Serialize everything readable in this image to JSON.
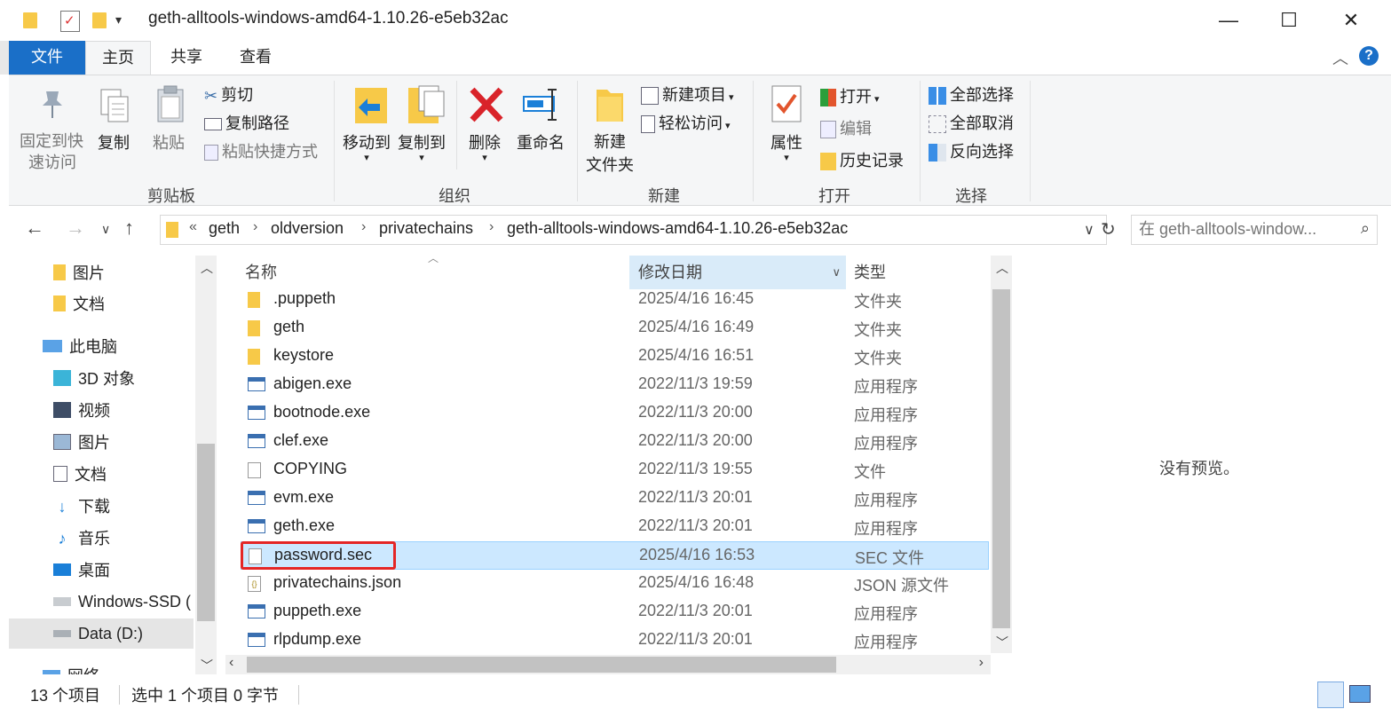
{
  "window": {
    "title": "geth-alltools-windows-amd64-1.10.26-e5eb32ac",
    "minimize": "—",
    "maximize": "☐",
    "close": "✕"
  },
  "tabs": [
    {
      "label": "文件"
    },
    {
      "label": "主页"
    },
    {
      "label": "共享"
    },
    {
      "label": "查看"
    }
  ],
  "ribbon": {
    "clipboard": {
      "group_label": "剪贴板",
      "pin_line1": "固定到快",
      "pin_line2": "速访问",
      "copy": "复制",
      "paste": "粘贴",
      "cut": "剪切",
      "copy_path": "复制路径",
      "paste_shortcut": "粘贴快捷方式"
    },
    "organize": {
      "group_label": "组织",
      "move_to": "移动到",
      "copy_to": "复制到",
      "delete": "删除",
      "rename": "重命名"
    },
    "new": {
      "group_label": "新建",
      "new_folder_line1": "新建",
      "new_folder_line2": "文件夹",
      "new_item": "新建项目",
      "easy_access": "轻松访问"
    },
    "open": {
      "group_label": "打开",
      "properties": "属性",
      "open": "打开",
      "edit": "编辑",
      "history": "历史记录"
    },
    "select": {
      "group_label": "选择",
      "select_all": "全部选择",
      "select_none": "全部取消",
      "invert": "反向选择"
    }
  },
  "address": {
    "overflow": "«",
    "crumbs": [
      "geth",
      "oldversion",
      "privatechains",
      "geth-alltools-windows-amd64-1.10.26-e5eb32ac"
    ],
    "search_placeholder": "在 geth-alltools-window..."
  },
  "nav_pane": [
    {
      "label": "图片",
      "icon": "folder-icon"
    },
    {
      "label": "文档",
      "icon": "folder-icon"
    },
    {
      "label": "此电脑",
      "icon": "computer-icon"
    },
    {
      "label": "3D 对象",
      "icon": "3d-objects-icon"
    },
    {
      "label": "视频",
      "icon": "video-icon"
    },
    {
      "label": "图片",
      "icon": "pictures-icon"
    },
    {
      "label": "文档",
      "icon": "documents-icon"
    },
    {
      "label": "下载",
      "icon": "download-icon"
    },
    {
      "label": "音乐",
      "icon": "music-icon"
    },
    {
      "label": "桌面",
      "icon": "desktop-icon"
    },
    {
      "label": "Windows-SSD (",
      "icon": "drive-icon"
    },
    {
      "label": "Data (D:)",
      "icon": "drive-icon"
    },
    {
      "label": "网络",
      "icon": "network-icon"
    }
  ],
  "columns": {
    "name": "名称",
    "date": "修改日期",
    "type": "类型"
  },
  "files": [
    {
      "name": ".puppeth",
      "date": "2025/4/16 16:45",
      "type": "文件夹",
      "kind": "folder"
    },
    {
      "name": "geth",
      "date": "2025/4/16 16:49",
      "type": "文件夹",
      "kind": "folder"
    },
    {
      "name": "keystore",
      "date": "2025/4/16 16:51",
      "type": "文件夹",
      "kind": "folder"
    },
    {
      "name": "abigen.exe",
      "date": "2022/11/3 19:59",
      "type": "应用程序",
      "kind": "exe"
    },
    {
      "name": "bootnode.exe",
      "date": "2022/11/3 20:00",
      "type": "应用程序",
      "kind": "exe"
    },
    {
      "name": "clef.exe",
      "date": "2022/11/3 20:00",
      "type": "应用程序",
      "kind": "exe"
    },
    {
      "name": "COPYING",
      "date": "2022/11/3 19:55",
      "type": "文件",
      "kind": "file"
    },
    {
      "name": "evm.exe",
      "date": "2022/11/3 20:01",
      "type": "应用程序",
      "kind": "exe"
    },
    {
      "name": "geth.exe",
      "date": "2022/11/3 20:01",
      "type": "应用程序",
      "kind": "exe"
    },
    {
      "name": "password.sec",
      "date": "2025/4/16 16:53",
      "type": "SEC 文件",
      "kind": "file"
    },
    {
      "name": "privatechains.json",
      "date": "2025/4/16 16:48",
      "type": "JSON 源文件",
      "kind": "json"
    },
    {
      "name": "puppeth.exe",
      "date": "2022/11/3 20:01",
      "type": "应用程序",
      "kind": "exe"
    },
    {
      "name": "rlpdump.exe",
      "date": "2022/11/3 20:01",
      "type": "应用程序",
      "kind": "exe"
    }
  ],
  "preview": {
    "text": "没有预览。"
  },
  "status": {
    "count": "13 个项目",
    "selection": "选中 1 个项目  0 字节"
  },
  "colors": {
    "accent": "#1a6fc8",
    "selection": "#cce8ff",
    "highlight_box": "#e42626",
    "folder": "#f7c948"
  }
}
